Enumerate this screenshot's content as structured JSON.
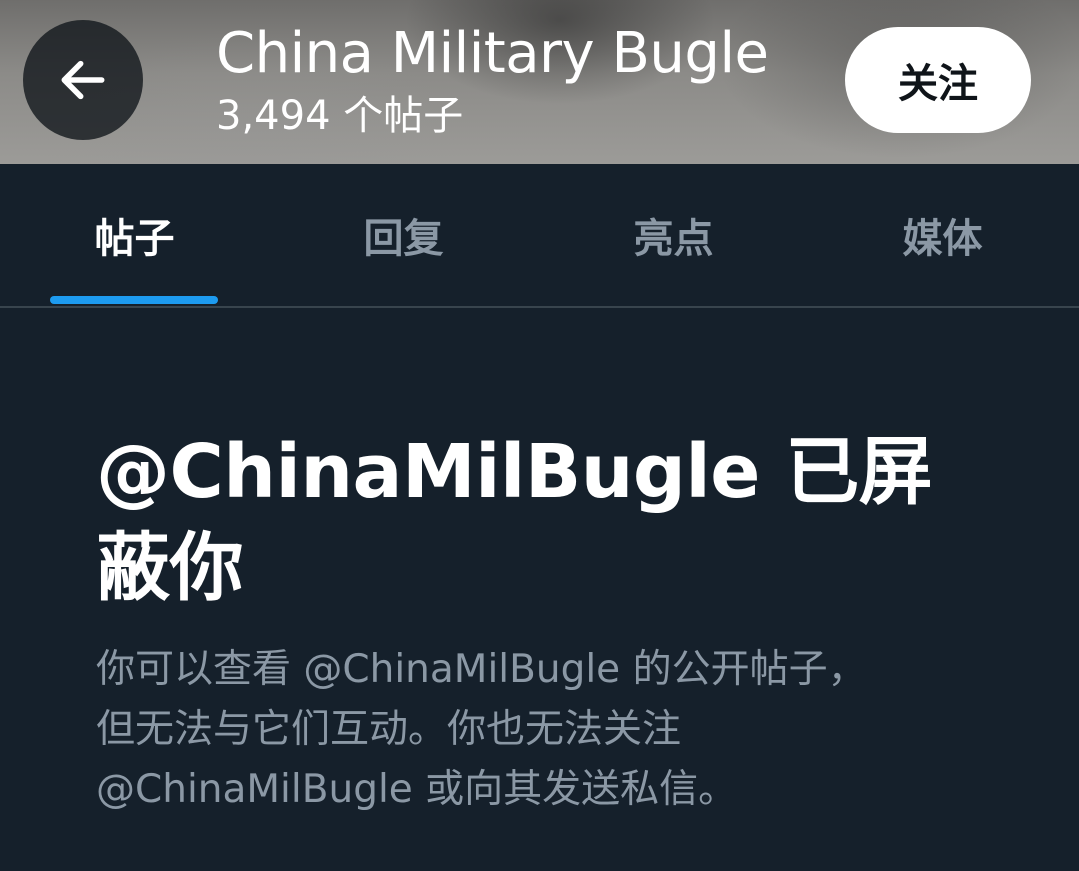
{
  "header": {
    "profile_name": "China Military Bugle",
    "post_count": "3,494 个帖子",
    "follow_label": "关注",
    "back_icon": "arrow-left-icon"
  },
  "tabs": [
    {
      "label": "帖子",
      "active": true
    },
    {
      "label": "回复",
      "active": false
    },
    {
      "label": "亮点",
      "active": false
    },
    {
      "label": "媒体",
      "active": false
    }
  ],
  "blocked": {
    "title": "@ChinaMilBugle 已屏蔽你",
    "description": "你可以查看 @ChinaMilBugle 的公开帖子，但无法与它们互动。你也无法关注 @ChinaMilBugle 或向其发送私信。"
  },
  "colors": {
    "background": "#15202b",
    "accent": "#1d9bf0",
    "secondary_text": "#8b98a5",
    "divider": "#38444d"
  }
}
